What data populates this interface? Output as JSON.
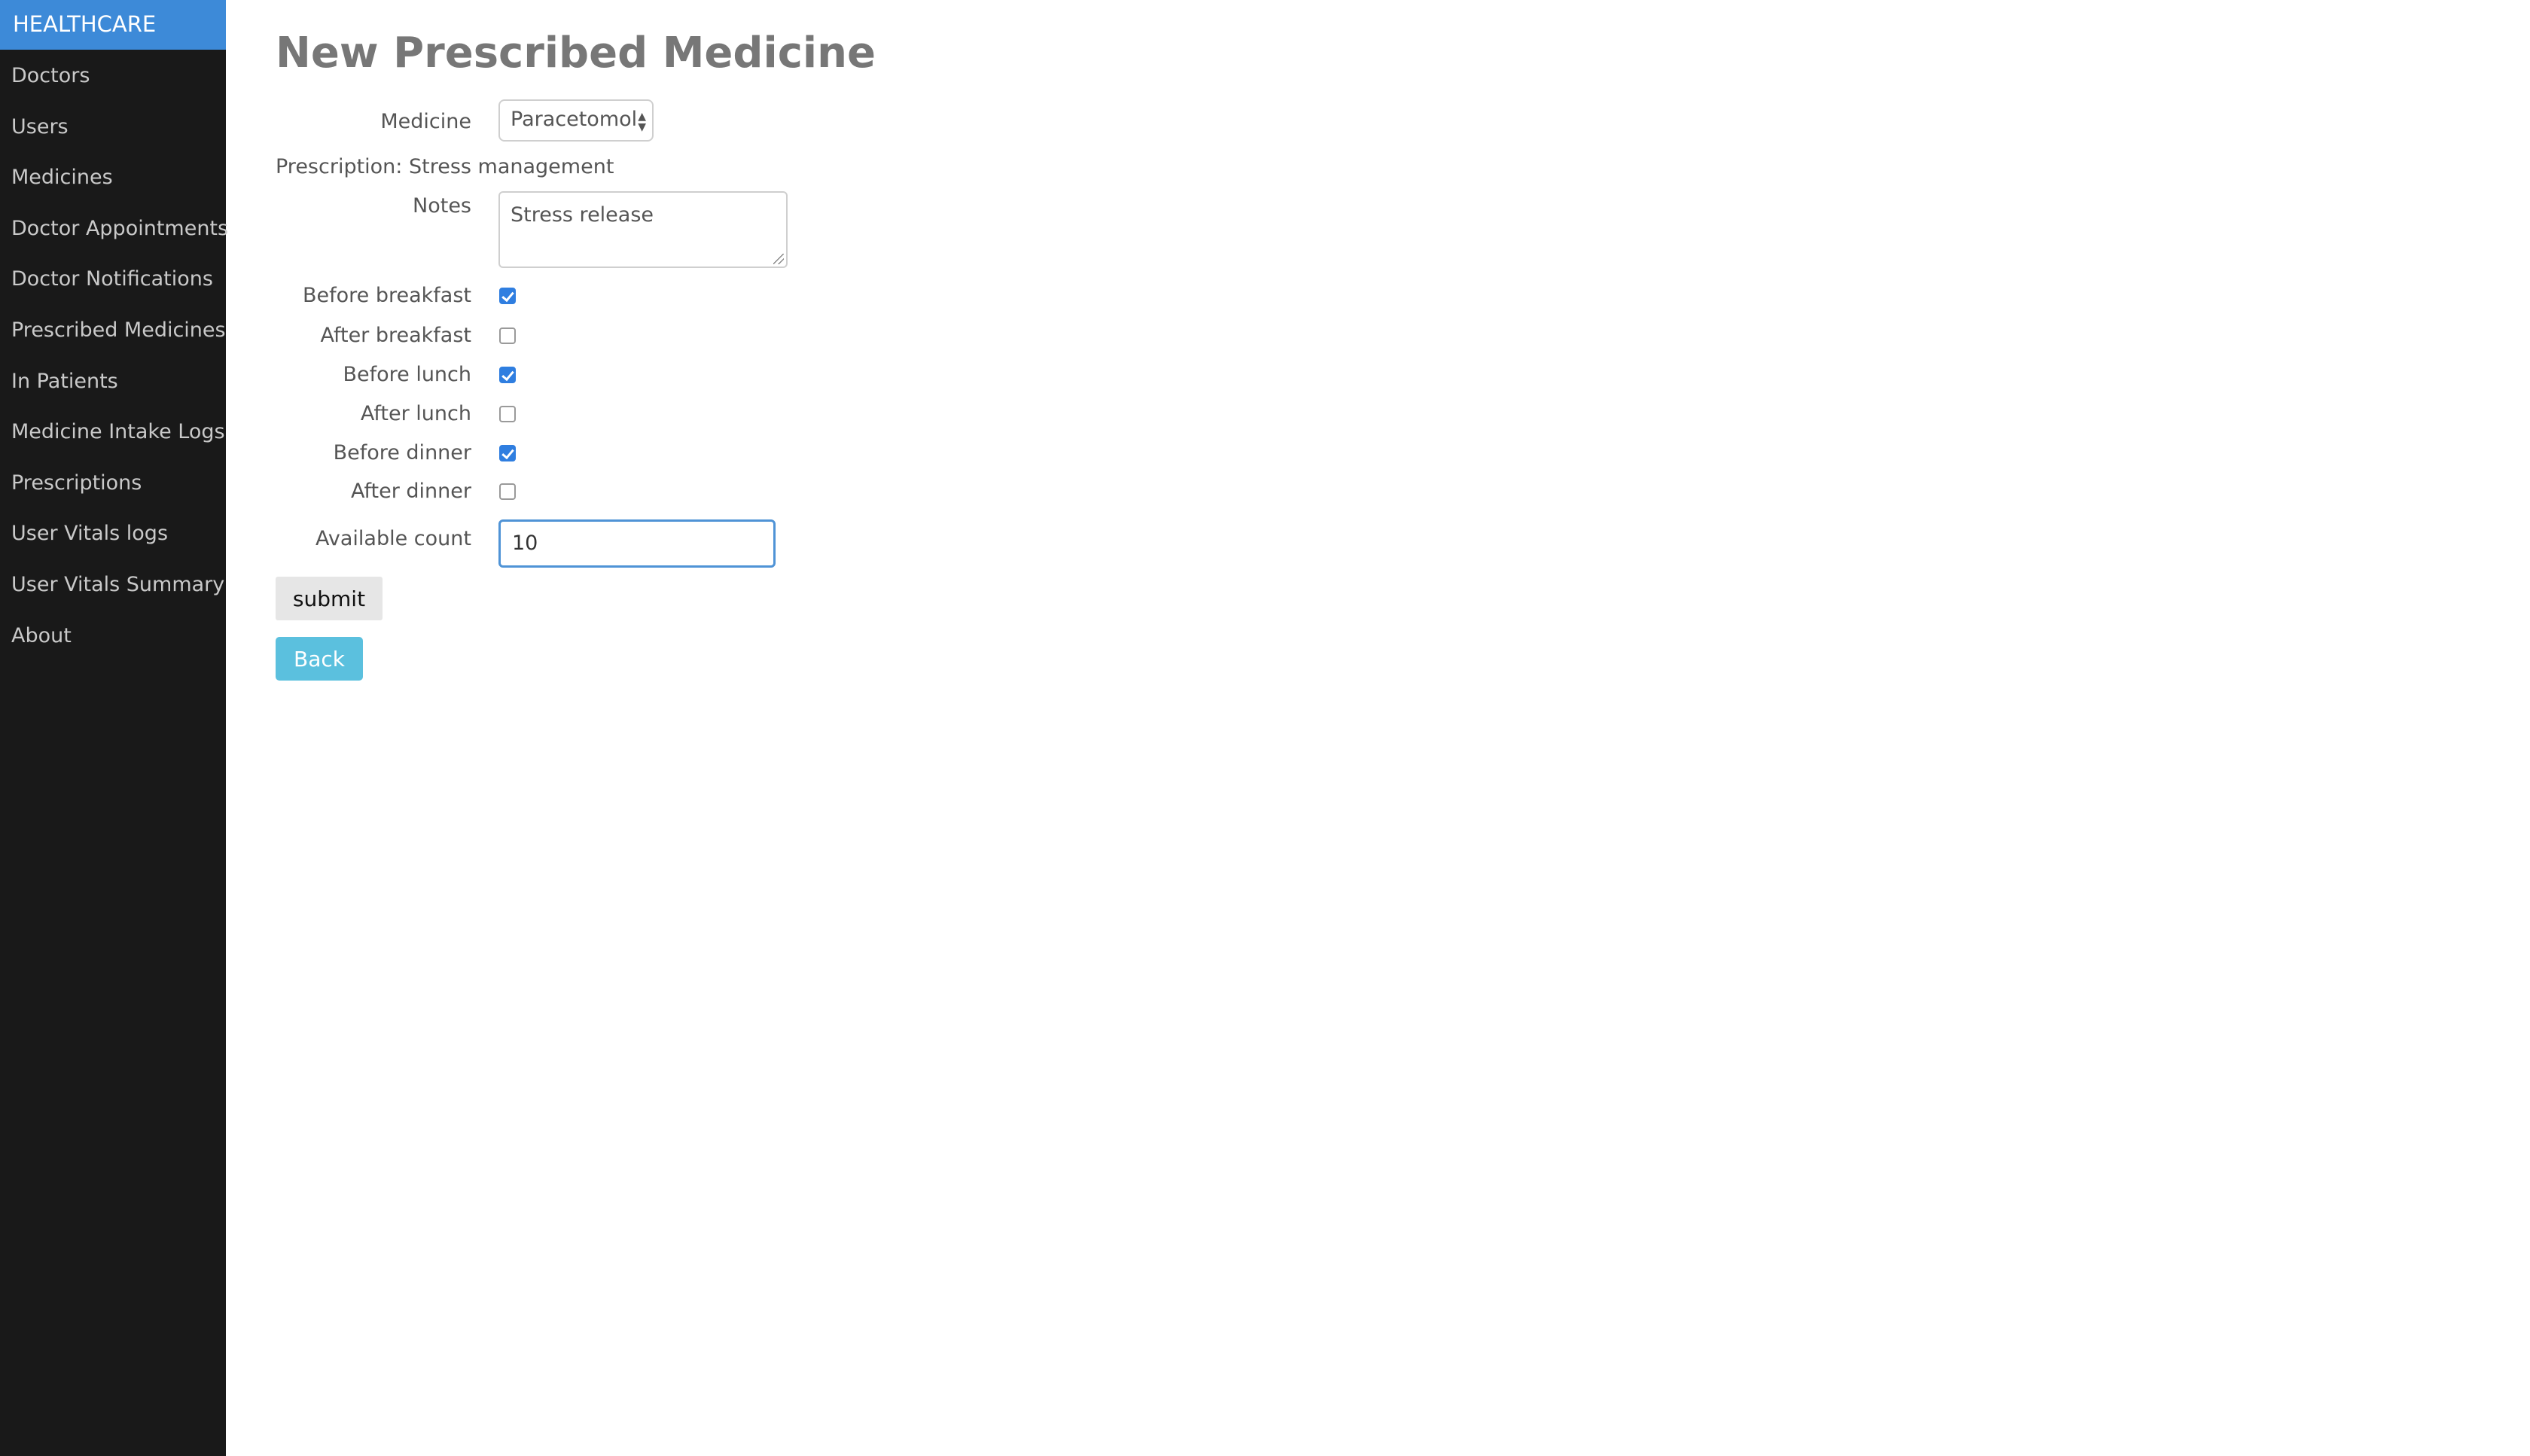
{
  "sidebar": {
    "brand": "HEALTHCARE",
    "items": [
      "Doctors",
      "Users",
      "Medicines",
      "Doctor Appointments",
      "Doctor Notifications",
      "Prescribed Medicines",
      "In Patients",
      "Medicine Intake Logs",
      "Prescriptions",
      "User Vitals logs",
      "User Vitals Summary",
      "About"
    ]
  },
  "page": {
    "title": "New Prescribed Medicine"
  },
  "form": {
    "medicine": {
      "label": "Medicine",
      "selected": "Paracetomol"
    },
    "prescription_text": "Prescription: Stress management",
    "notes": {
      "label": "Notes",
      "value": "Stress release"
    },
    "checkboxes": [
      {
        "label": "Before breakfast",
        "checked": true
      },
      {
        "label": "After breakfast",
        "checked": false
      },
      {
        "label": "Before lunch",
        "checked": true
      },
      {
        "label": "After lunch",
        "checked": false
      },
      {
        "label": "Before dinner",
        "checked": true
      },
      {
        "label": "After dinner",
        "checked": false
      }
    ],
    "available_count": {
      "label": "Available count",
      "value": "10"
    },
    "submit_label": "submit",
    "back_label": "Back"
  },
  "colors": {
    "sidebar_bg": "#191919",
    "brand_bg": "#3d8ad8",
    "checkbox_checked": "#2f7ee0",
    "back_button": "#5bc0de",
    "focus_border": "#4f93d6"
  }
}
